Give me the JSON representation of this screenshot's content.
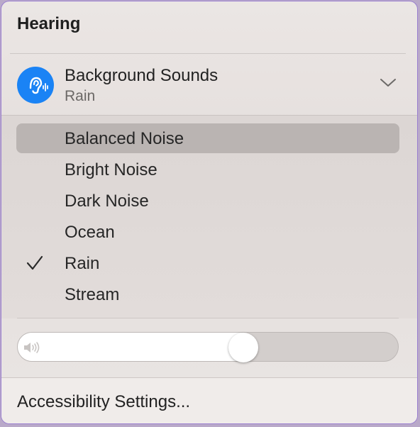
{
  "section": {
    "title": "Hearing"
  },
  "background_sounds": {
    "title": "Background Sounds",
    "current": "Rain",
    "icon": "ear-sound-icon",
    "accent_color": "#1a83f5"
  },
  "sound_options": {
    "items": [
      {
        "label": "Balanced Noise",
        "highlighted": true,
        "checked": false
      },
      {
        "label": "Bright Noise",
        "highlighted": false,
        "checked": false
      },
      {
        "label": "Dark Noise",
        "highlighted": false,
        "checked": false
      },
      {
        "label": "Ocean",
        "highlighted": false,
        "checked": false
      },
      {
        "label": "Rain",
        "highlighted": false,
        "checked": true
      },
      {
        "label": "Stream",
        "highlighted": false,
        "checked": false
      }
    ]
  },
  "volume": {
    "level_fraction": 0.6,
    "icon": "speaker-icon"
  },
  "footer": {
    "settings_label": "Accessibility Settings..."
  }
}
